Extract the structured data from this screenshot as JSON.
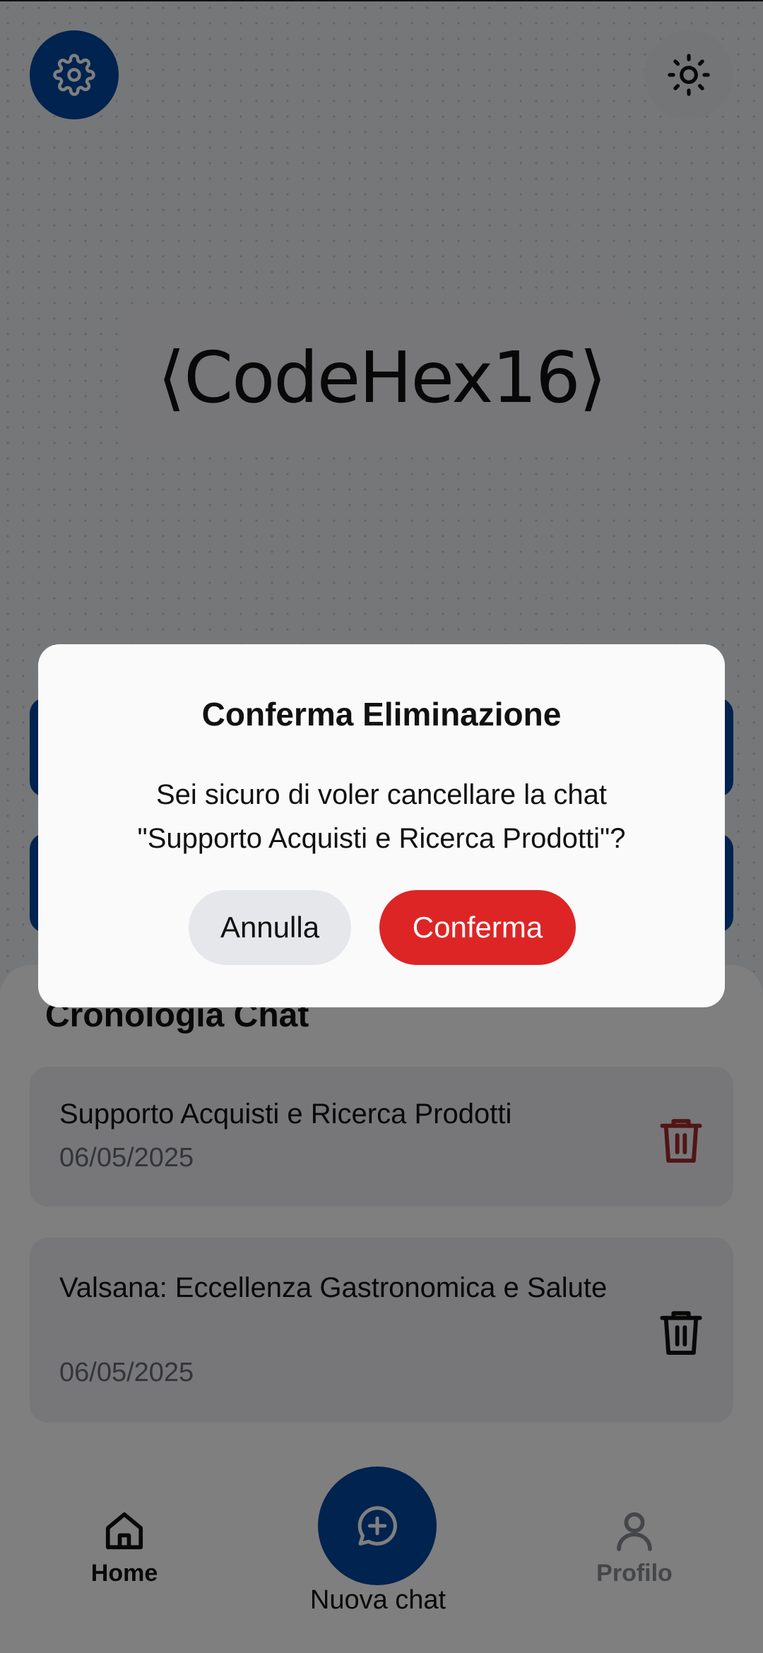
{
  "header": {
    "settings_icon": "gear-icon",
    "theme_icon": "sun-icon"
  },
  "logo": {
    "text": "CodeHex16",
    "left_bracket": "⟨",
    "right_bracket": "⟩"
  },
  "history": {
    "title": "Cronologia Chat",
    "items": [
      {
        "title": "Supporto Acquisti e Ricerca Prodotti",
        "date": "06/05/2025",
        "trash_color": "#a32b2b"
      },
      {
        "title": "Valsana: Eccellenza Gastronomica e Salute",
        "date": "06/05/2025",
        "trash_color": "#111111"
      }
    ]
  },
  "nav": {
    "home_label": "Home",
    "new_chat_label": "Nuova chat",
    "profile_label": "Profilo"
  },
  "dialog": {
    "title": "Conferma Eliminazione",
    "message": "Sei sicuro di voler cancellare la chat\n\"Supporto Acquisti e Ricerca Prodotti\"?",
    "cancel_label": "Annulla",
    "confirm_label": "Conferma"
  },
  "colors": {
    "accent": "#00479e",
    "danger": "#dd2526"
  }
}
